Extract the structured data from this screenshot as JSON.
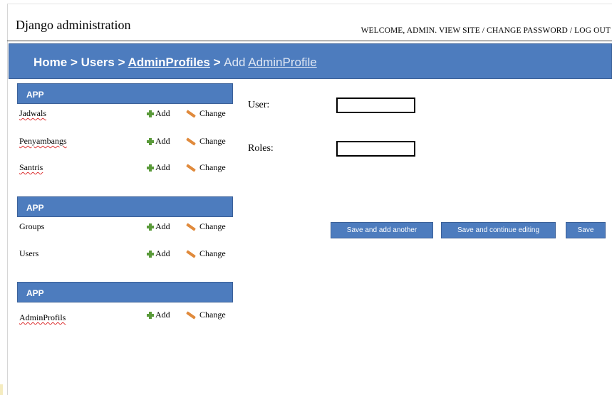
{
  "header": {
    "site_name": "Django administration",
    "user_tools": "WELCOME, ADMIN. VIEW SITE / CHANGE PASSWORD / LOG OUT"
  },
  "breadcrumbs": {
    "home": "Home",
    "sep1": " > ",
    "users": "Users",
    "sep2": " > ",
    "adminprofiles": "AdminProfiles",
    "sep3": " > ",
    "current_prefix": "Add ",
    "current_model": "AdminProfile"
  },
  "sidebar": {
    "modules": [
      {
        "title": "APP",
        "models": [
          {
            "name": "Jadwals",
            "add": "Add",
            "change": "Change"
          },
          {
            "name": "Penyambangs",
            "add": "Add",
            "change": "Change"
          },
          {
            "name": "Santris",
            "add": "Add",
            "change": "Change"
          }
        ]
      },
      {
        "title": "APP",
        "models": [
          {
            "name": "Groups",
            "add": "Add",
            "change": "Change"
          },
          {
            "name": "Users",
            "add": "Add",
            "change": "Change"
          }
        ]
      },
      {
        "title": "APP",
        "models": [
          {
            "name": "AdminProfils",
            "add": "Add",
            "change": "Change"
          }
        ]
      }
    ]
  },
  "form": {
    "user_label": "User:",
    "user_value": "",
    "roles_label": "Roles:",
    "roles_value": ""
  },
  "buttons": {
    "save_add_another": "Save and add another",
    "save_continue": "Save and continue editing",
    "save": "Save"
  },
  "colors": {
    "accent": "#4d7cbe",
    "add_icon": "#5a9a3a",
    "change_icon": "#e08a3c"
  }
}
